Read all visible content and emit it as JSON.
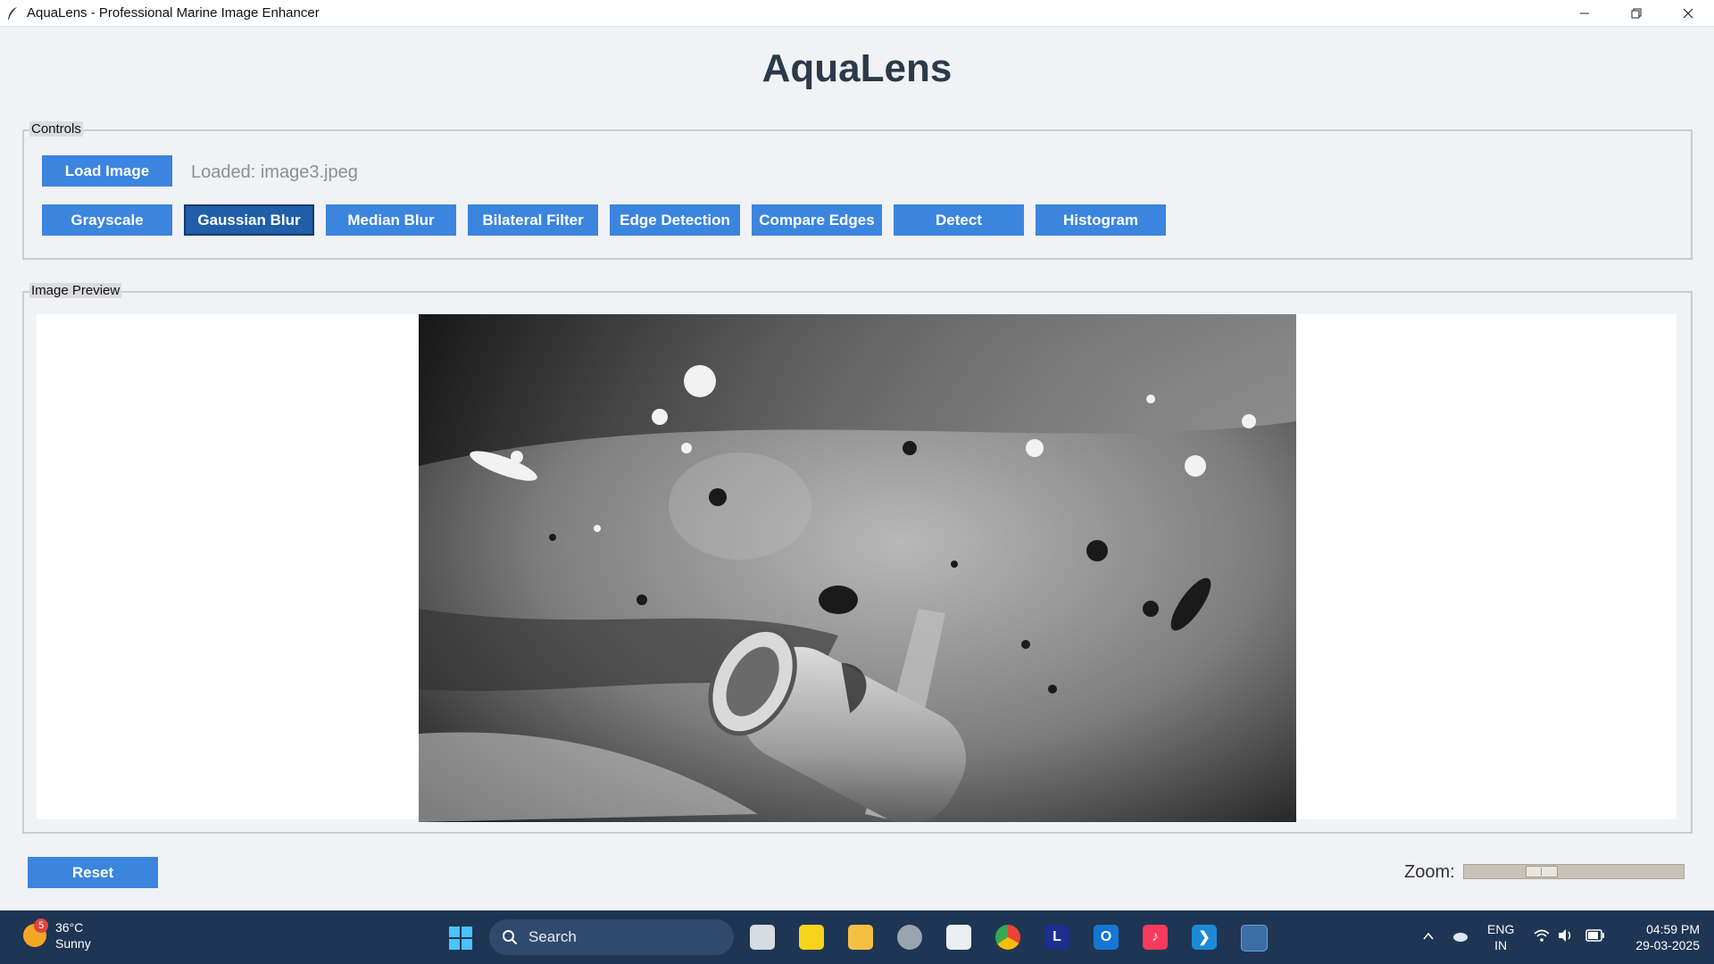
{
  "window": {
    "title": "AquaLens - Professional Marine Image Enhancer"
  },
  "header": {
    "title": "AquaLens"
  },
  "controls": {
    "legend": "Controls",
    "load_button": "Load Image",
    "loaded_status": "Loaded: image3.jpeg",
    "filter_buttons": [
      {
        "label": "Grayscale"
      },
      {
        "label": "Gaussian Blur",
        "active": true
      },
      {
        "label": "Median Blur"
      },
      {
        "label": "Bilateral Filter"
      },
      {
        "label": "Edge Detection"
      },
      {
        "label": "Compare Edges"
      },
      {
        "label": "Detect"
      },
      {
        "label": "Histogram"
      }
    ]
  },
  "preview": {
    "legend": "Image Preview",
    "image_description_icon": "grayscale-underwater-bottle-photo"
  },
  "footer": {
    "reset_button": "Reset",
    "zoom_label": "Zoom:",
    "zoom_level_fraction": 0.33
  },
  "taskbar": {
    "weather": {
      "temp": "36°C",
      "condition": "Sunny",
      "badge": "5"
    },
    "search_placeholder": "Search",
    "pinned_icons": [
      "task-view-icon",
      "sticky-notes-icon",
      "file-explorer-icon",
      "settings-icon",
      "microsoft-store-icon",
      "chrome-icon",
      "lens-app-icon",
      "outlook-icon",
      "music-icon",
      "vscode-icon",
      "python-icon"
    ],
    "tray": {
      "lang_line1": "ENG",
      "lang_line2": "IN",
      "time": "04:59 PM",
      "date": "29-03-2025"
    }
  },
  "colors": {
    "button_blue": "#3b85de",
    "button_active": "#1f5ea8",
    "title_color": "#2b3a4a",
    "taskbar_bg": "#1f3554"
  }
}
